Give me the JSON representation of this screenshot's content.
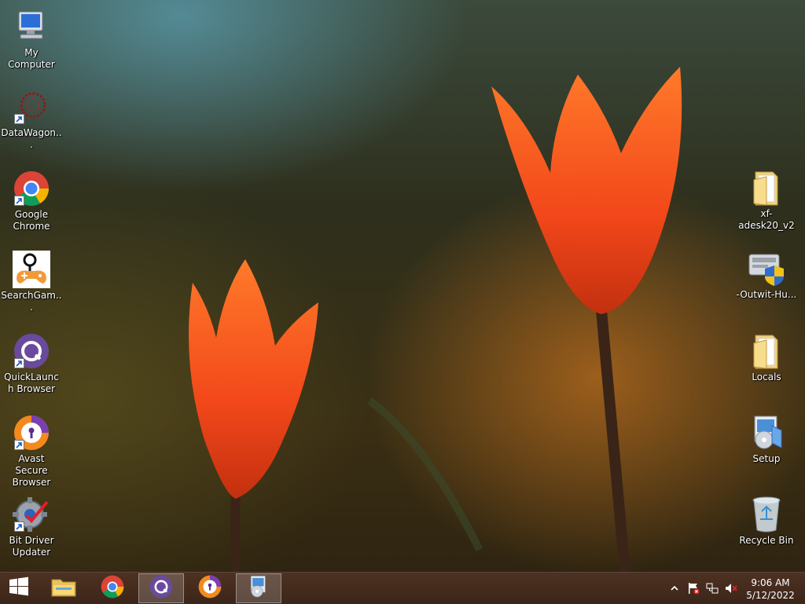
{
  "desktop": {
    "left_icons": [
      {
        "label": "My Computer",
        "icon": "computer-icon"
      },
      {
        "label": "DataWagon...",
        "icon": "datawagon-icon"
      },
      {
        "label": "Google Chrome",
        "icon": "chrome-icon"
      },
      {
        "label": "SearchGam...",
        "icon": "gamepad-icon"
      },
      {
        "label": "QuickLaunch Browser",
        "icon": "quicklaunch-icon"
      },
      {
        "label": "Avast Secure Browser",
        "icon": "avast-icon"
      },
      {
        "label": "Bit Driver Updater",
        "icon": "gear-icon"
      }
    ],
    "right_icons": [
      {
        "label": "xf-adesk20_v2",
        "icon": "folder-icon"
      },
      {
        "label": "-Outwit-Hu...",
        "icon": "installer-icon"
      },
      {
        "label": "Locals",
        "icon": "folder-icon"
      },
      {
        "label": "Setup",
        "icon": "setup-icon"
      },
      {
        "label": "Recycle Bin",
        "icon": "recycle-bin-icon"
      }
    ]
  },
  "taskbar": {
    "pinned": [
      "start-icon",
      "file-explorer-icon",
      "chrome-icon",
      "quicklaunch-icon",
      "avast-icon",
      "setup-icon"
    ],
    "clock": {
      "time": "9:06 AM",
      "date": "5/12/2022"
    },
    "tray": [
      "chevron-up-icon",
      "flag-icon",
      "network-icon",
      "speaker-muted-icon"
    ]
  },
  "colors": {
    "taskbar": "#4a3020",
    "accent": "#ff5a1f"
  }
}
